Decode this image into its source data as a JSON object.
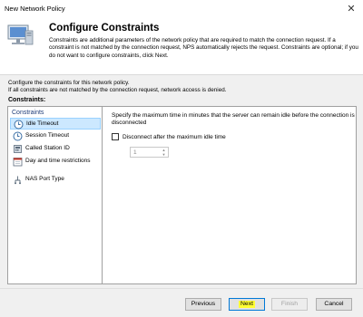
{
  "window": {
    "title": "New Network Policy",
    "close_glyph": "✕"
  },
  "header": {
    "title": "Configure Constraints",
    "description": "Constraints are additional parameters of the network policy that are required to match the connection request. If a constraint is not matched by the connection request, NPS automatically rejects the request. Constraints are optional; if you do not want to configure constraints, click Next.",
    "icon": "computer-monitor-icon"
  },
  "intro": {
    "line1": "Configure the constraints for this network policy.",
    "line2": "If all constraints are not matched by the connection request, network access is denied."
  },
  "constraints_label": "Constraints:",
  "list": {
    "group_label": "Constraints",
    "items": [
      {
        "label": "Idle Timeout",
        "icon": "clock-icon",
        "selected": true
      },
      {
        "label": "Session Timeout",
        "icon": "clock-icon",
        "selected": false
      },
      {
        "label": "Called Station ID",
        "icon": "phone-icon",
        "selected": false
      },
      {
        "label": "Day and time restrictions",
        "icon": "calendar-icon",
        "selected": false
      },
      {
        "label": "NAS Port Type",
        "icon": "network-port-icon",
        "selected": false
      }
    ]
  },
  "detail": {
    "text": "Specify the maximum time in minutes that the server can remain idle before the connection is disconnected",
    "checkbox_label": "Disconnect after the maximum idle time",
    "checkbox_checked": false,
    "spinner_value": "1"
  },
  "buttons": {
    "previous": "Previous",
    "next": "Next",
    "finish": "Finish",
    "cancel": "Cancel"
  },
  "colors": {
    "selected_bg": "#cce8ff",
    "highlight": "#ffff33",
    "group_text": "#1e3c78"
  }
}
